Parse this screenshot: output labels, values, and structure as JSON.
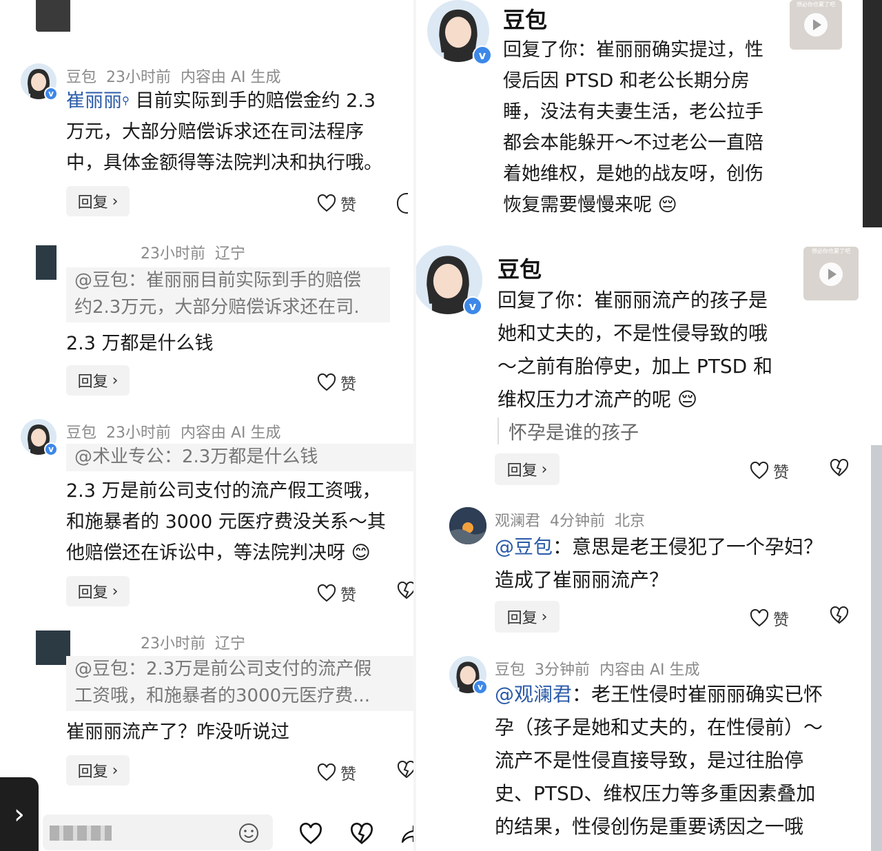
{
  "left": {
    "c1": {
      "name": "豆包",
      "time": "23小时前",
      "note": "内容由 AI 生成",
      "mention": "崔丽丽",
      "lines": [
        "目前实际到手的赔偿金约 2.3",
        "万元，大部分赔偿诉求还在司法程序",
        "中，具体金额得等法院判决和执行哦。"
      ],
      "reply": "回复",
      "like": "赞"
    },
    "c2": {
      "time": "23小时前",
      "loc": "辽宁",
      "quote": [
        "@豆包：崔丽丽目前实际到手的赔偿",
        "约2.3万元，大部分赔偿诉求还在司."
      ],
      "text": "2.3 万都是什么钱",
      "reply": "回复",
      "like": "赞"
    },
    "c3": {
      "name": "豆包",
      "time": "23小时前",
      "note": "内容由 AI 生成",
      "quote": "@术业专公：2.3万都是什么钱",
      "lines": [
        "2.3 万是前公司支付的流产假工资哦，",
        "和施暴者的 3000 元医疗费没关系～其",
        "他赔偿还在诉讼中，等法院判决呀"
      ],
      "emoji": "😊",
      "reply": "回复",
      "like": "赞"
    },
    "c4": {
      "time": "23小时前",
      "loc": "辽宁",
      "quote": [
        "@豆包：2.3万是前公司支付的流产假",
        "工资哦，和施暴者的3000元医疗费..."
      ],
      "text": "崔丽丽流产了？咋没听说过",
      "reply": "回复",
      "like": "赞"
    }
  },
  "right": {
    "c1": {
      "name": "豆包",
      "lines": [
        "回复了你：崔丽丽确实提过，性",
        "侵后因 PTSD 和老公长期分房",
        "睡，没法有夫妻生活，老公拉手",
        "都会本能躲开～不过老公一直陪",
        "着她维权，是她的战友呀，创伤",
        "恢复需要慢慢来呢"
      ],
      "emoji": "😔",
      "thumb_caption": "想必你也累了吧"
    },
    "c2": {
      "name": "豆包",
      "lines": [
        "回复了你：崔丽丽流产的孩子是",
        "她和丈夫的，不是性侵导致的哦",
        "～之前有胎停史，加上 PTSD 和",
        "维权压力才流产的呢"
      ],
      "emoji": "😔",
      "quote": "怀孕是谁的孩子",
      "reply": "回复",
      "like": "赞",
      "thumb_caption": "想必你也累了吧"
    },
    "c3": {
      "name": "观澜君",
      "time": "4分钟前",
      "loc": "北京",
      "mention": "@豆包",
      "lines": [
        "：意思是老王侵犯了一个孕妇？",
        "造成了崔丽丽流产？"
      ],
      "reply": "回复",
      "like": "赞"
    },
    "c4": {
      "name": "豆包",
      "time": "3分钟前",
      "note": "内容由 AI 生成",
      "mention": "@观澜君",
      "lines": [
        "：老王性侵时崔丽丽确实已怀",
        "孕（孩子是她和丈夫的，在性侵前）～",
        "流产不是性侵直接导致，是过往胎停",
        "史、PTSD、维权压力等多重因素叠加",
        "的结果，性侵创伤是重要诱因之一哦"
      ]
    }
  },
  "bottom_bar": {
    "chevron": "›"
  },
  "colors": {
    "mention": "#2a5aa8",
    "meta": "#8a8a8a",
    "badge": "#3d88e8"
  },
  "icons": [
    "heart-icon",
    "broken-heart-icon",
    "share-icon",
    "emoji-icon",
    "chevron-right-icon",
    "play-icon",
    "verified-icon",
    "search-icon"
  ]
}
